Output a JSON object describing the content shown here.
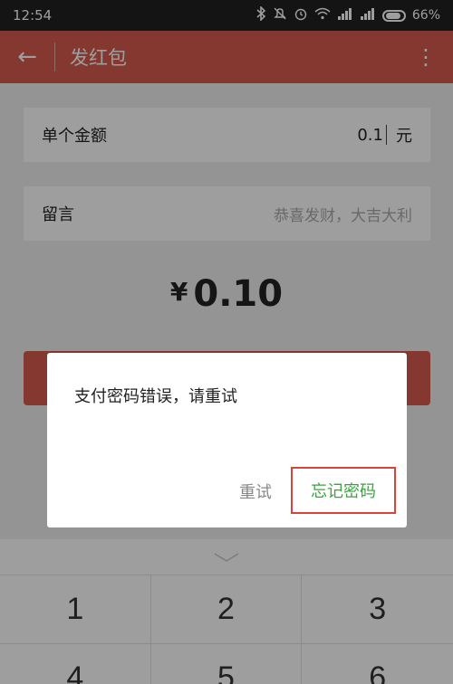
{
  "status_bar": {
    "time": "12:54",
    "battery_percent": "66%",
    "icons": [
      "bluetooth-icon",
      "mute-icon",
      "alarm-icon",
      "wifi-icon",
      "signal-icon",
      "signal-icon",
      "battery-icon"
    ]
  },
  "app_bar": {
    "title": "发红包",
    "back_icon": "arrow-left",
    "more_icon": "more-vertical"
  },
  "form": {
    "amount_label": "单个金额",
    "amount_value": "0.1",
    "amount_unit": "元",
    "message_label": "留言",
    "message_placeholder": "恭喜发财，大吉大利"
  },
  "total": {
    "currency": "¥",
    "value": "0.10"
  },
  "dialog": {
    "message": "支付密码错误，请重试",
    "retry_label": "重试",
    "forgot_label": "忘记密码"
  },
  "keypad": {
    "keys": [
      "1",
      "2",
      "3",
      "4",
      "5",
      "6"
    ]
  },
  "colors": {
    "brand": "#d65b4e",
    "status_bar": "#212121",
    "forgot_text": "#3aa53d",
    "highlight_border": "#d9433a"
  }
}
